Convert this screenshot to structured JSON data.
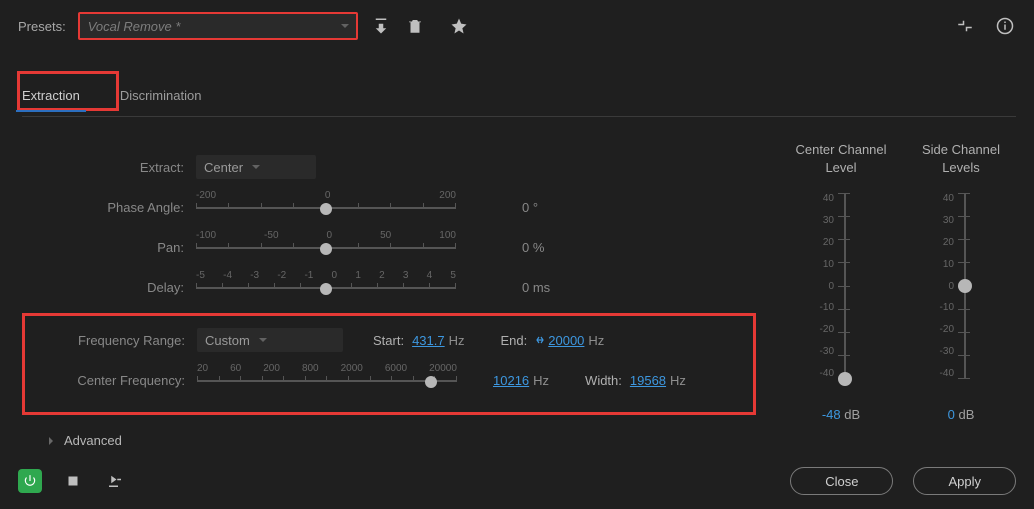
{
  "presets": {
    "label": "Presets:",
    "value": "Vocal Remove *"
  },
  "tabs": {
    "extraction": "Extraction",
    "discrimination": "Discrimination"
  },
  "controls": {
    "extract": {
      "label": "Extract:",
      "value": "Center"
    },
    "phase": {
      "label": "Phase Angle:",
      "ticks": [
        "-200",
        "0",
        "200"
      ],
      "out": "0 °"
    },
    "pan": {
      "label": "Pan:",
      "ticks": [
        "-100",
        "-50",
        "0",
        "50",
        "100"
      ],
      "out": "0 %"
    },
    "delay": {
      "label": "Delay:",
      "ticks": [
        "-5",
        "-4",
        "-3",
        "-2",
        "-1",
        "0",
        "1",
        "2",
        "3",
        "4",
        "5"
      ],
      "out": "0 ms"
    }
  },
  "freq": {
    "range_label": "Frequency Range:",
    "range_value": "Custom",
    "start_label": "Start:",
    "start_value": "431.7",
    "start_unit": "Hz",
    "end_label": "End:",
    "end_value": "20000",
    "end_unit": "Hz",
    "center_label": "Center Frequency:",
    "center_ticks": [
      "20",
      "60",
      "200",
      "800",
      "2000",
      "6000",
      "20000"
    ],
    "center_value": "10216",
    "center_unit": "Hz",
    "width_label": "Width:",
    "width_value": "19568",
    "width_unit": "Hz"
  },
  "levels": {
    "center_head": "Center Channel Level",
    "side_head": "Side Channel Levels",
    "ticks": [
      "40",
      "30",
      "20",
      "10",
      "0",
      "-10",
      "-20",
      "-30",
      "-40"
    ],
    "center_val": "-48",
    "side_val": "0",
    "unit": "dB"
  },
  "advanced": "Advanced",
  "buttons": {
    "close": "Close",
    "apply": "Apply"
  },
  "chart_data": {
    "type": "table",
    "title": "Center Channel Extract effect parameters",
    "items": [
      {
        "name": "Extract",
        "value": "Center"
      },
      {
        "name": "Phase Angle",
        "value": 0,
        "unit": "°",
        "range": [
          -200,
          200
        ]
      },
      {
        "name": "Pan",
        "value": 0,
        "unit": "%",
        "range": [
          -100,
          100
        ]
      },
      {
        "name": "Delay",
        "value": 0,
        "unit": "ms",
        "range": [
          -5,
          5
        ]
      },
      {
        "name": "Frequency Range Start",
        "value": 431.7,
        "unit": "Hz"
      },
      {
        "name": "Frequency Range End",
        "value": 20000,
        "unit": "Hz"
      },
      {
        "name": "Center Frequency",
        "value": 10216,
        "unit": "Hz",
        "range": [
          20,
          20000
        ]
      },
      {
        "name": "Width",
        "value": 19568,
        "unit": "Hz"
      },
      {
        "name": "Center Channel Level",
        "value": -48,
        "unit": "dB",
        "range": [
          -40,
          40
        ]
      },
      {
        "name": "Side Channel Levels",
        "value": 0,
        "unit": "dB",
        "range": [
          -40,
          40
        ]
      }
    ]
  }
}
